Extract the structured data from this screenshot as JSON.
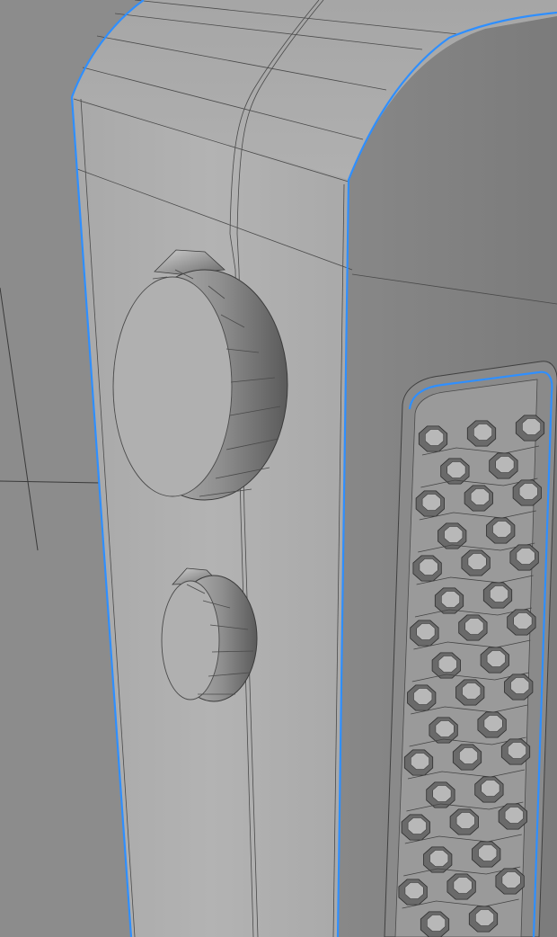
{
  "viewport": {
    "background_color": "#8c8c8c",
    "selection_color": "#2f8fff",
    "mesh_light": "#b4b4b4",
    "mesh_mid": "#a2a2a2",
    "mesh_dark": "#7a7a7a",
    "wire_color": "#4a4a4a"
  },
  "objects": {
    "large_knob": {
      "icon": "knob-large-icon"
    },
    "small_knob": {
      "icon": "knob-small-icon"
    },
    "speaker_grille": {
      "icon": "speaker-grille-icon",
      "rows": 16
    }
  }
}
